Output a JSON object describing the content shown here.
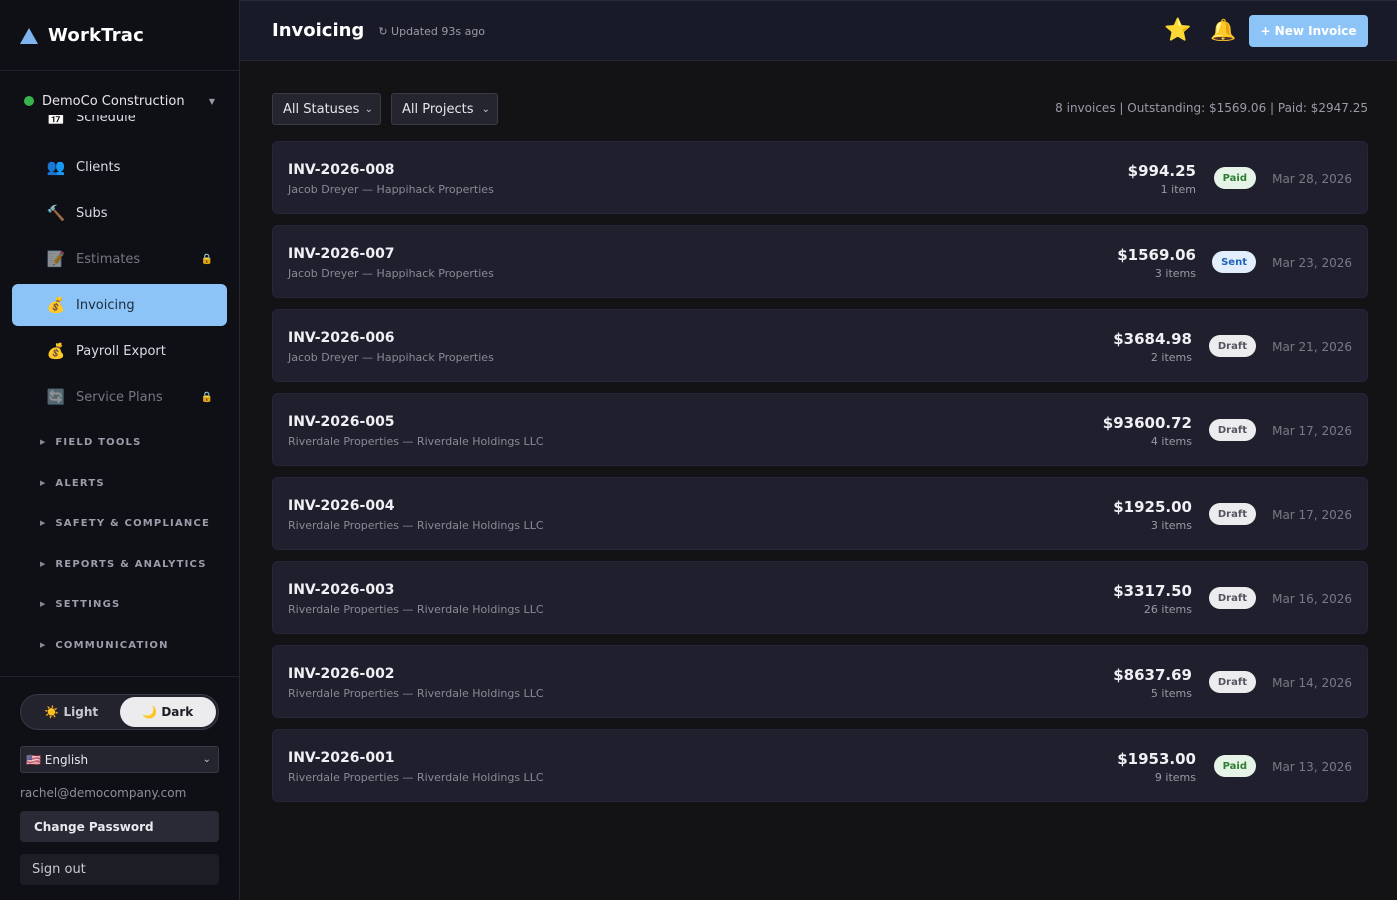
{
  "app": {
    "name": "WorkTrac"
  },
  "company": {
    "name": "DemoCo Construction"
  },
  "nav": {
    "partial_item": "Schedule",
    "items": [
      {
        "label": "Clients",
        "icon": "👥",
        "locked": false,
        "active": false
      },
      {
        "label": "Subs",
        "icon": "🔨",
        "locked": false,
        "active": false
      },
      {
        "label": "Estimates",
        "icon": "📝",
        "locked": true,
        "active": false
      },
      {
        "label": "Invoicing",
        "icon": "💰",
        "locked": false,
        "active": true
      },
      {
        "label": "Payroll Export",
        "icon": "💰",
        "locked": false,
        "active": false
      },
      {
        "label": "Service Plans",
        "icon": "🔄",
        "locked": true,
        "active": false
      }
    ],
    "sections": [
      "FIELD TOOLS",
      "ALERTS",
      "SAFETY & COMPLIANCE",
      "REPORTS & ANALYTICS",
      "SETTINGS",
      "COMMUNICATION"
    ]
  },
  "footer": {
    "theme_light": "☀️ Light",
    "theme_dark": "🌙 Dark",
    "language": "🇺🇸 English",
    "email": "rachel@democompany.com",
    "change_password": "Change Password",
    "sign_out": "Sign out"
  },
  "header": {
    "title": "Invoicing",
    "updated": "↻ Updated 93s ago",
    "new_invoice": "+ New Invoice"
  },
  "filters": {
    "status": "All Statuses",
    "project": "All Projects"
  },
  "summary": "8 invoices | Outstanding: $1569.06 | Paid: $2947.25",
  "colors": {
    "accent": "#8cc4f7",
    "paid_bg": "#e6f4e8",
    "paid_fg": "#2e7d32",
    "sent_bg": "#e3eefc",
    "sent_fg": "#1e63b8",
    "draft_bg": "#ececef",
    "draft_fg": "#555560"
  },
  "invoices": [
    {
      "number": "INV-2026-008",
      "client": "Jacob Dreyer — Happihack Properties",
      "amount": "$994.25",
      "items": "1 item",
      "status": "Paid",
      "date": "Mar 28, 2026"
    },
    {
      "number": "INV-2026-007",
      "client": "Jacob Dreyer — Happihack Properties",
      "amount": "$1569.06",
      "items": "3 items",
      "status": "Sent",
      "date": "Mar 23, 2026"
    },
    {
      "number": "INV-2026-006",
      "client": "Jacob Dreyer — Happihack Properties",
      "amount": "$3684.98",
      "items": "2 items",
      "status": "Draft",
      "date": "Mar 21, 2026"
    },
    {
      "number": "INV-2026-005",
      "client": "Riverdale Properties — Riverdale Holdings LLC",
      "amount": "$93600.72",
      "items": "4 items",
      "status": "Draft",
      "date": "Mar 17, 2026"
    },
    {
      "number": "INV-2026-004",
      "client": "Riverdale Properties — Riverdale Holdings LLC",
      "amount": "$1925.00",
      "items": "3 items",
      "status": "Draft",
      "date": "Mar 17, 2026"
    },
    {
      "number": "INV-2026-003",
      "client": "Riverdale Properties — Riverdale Holdings LLC",
      "amount": "$3317.50",
      "items": "26 items",
      "status": "Draft",
      "date": "Mar 16, 2026"
    },
    {
      "number": "INV-2026-002",
      "client": "Riverdale Properties — Riverdale Holdings LLC",
      "amount": "$8637.69",
      "items": "5 items",
      "status": "Draft",
      "date": "Mar 14, 2026"
    },
    {
      "number": "INV-2026-001",
      "client": "Riverdale Properties — Riverdale Holdings LLC",
      "amount": "$1953.00",
      "items": "9 items",
      "status": "Paid",
      "date": "Mar 13, 2026"
    }
  ]
}
